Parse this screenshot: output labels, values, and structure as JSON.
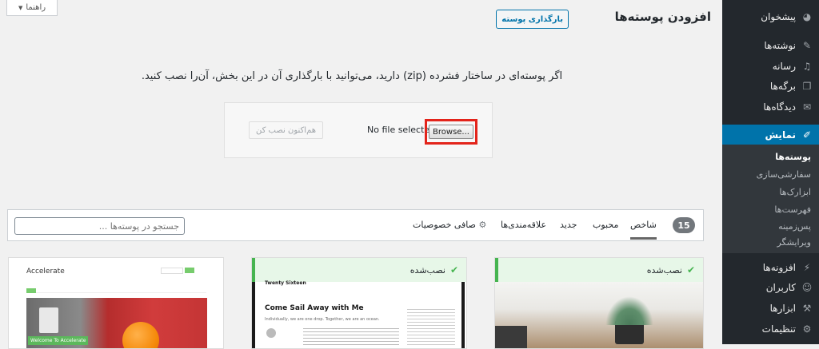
{
  "help_tab": "راهنما",
  "page": {
    "title": "افزودن پوسته‌ها",
    "upload_button": "بارگذاری پوسته",
    "instruction": "اگر پوسته‌ای در ساختار فشرده (zip) دارید، می‌توانید با بارگذاری آن در این بخش، آن‌را نصب کنید.",
    "install_now": "هم‌اکنون نصب کن",
    "no_file": "No file selected.",
    "browse": "Browse..."
  },
  "sidebar": {
    "items": [
      {
        "label": "پیشخوان",
        "icon": "dashboard-icon",
        "glyph": "◕"
      },
      {
        "label": "نوشته‌ها",
        "icon": "pin-icon",
        "glyph": "✎"
      },
      {
        "label": "رسانه",
        "icon": "media-icon",
        "glyph": "♫"
      },
      {
        "label": "برگه‌ها",
        "icon": "pages-icon",
        "glyph": "❐"
      },
      {
        "label": "دیدگاه‌ها",
        "icon": "comments-icon",
        "glyph": "✉"
      },
      {
        "label": "نمایش",
        "icon": "appearance-icon",
        "glyph": "✐"
      },
      {
        "label": "افزونه‌ها",
        "icon": "plugins-icon",
        "glyph": "⚡"
      },
      {
        "label": "کاربران",
        "icon": "users-icon",
        "glyph": "☺"
      },
      {
        "label": "ابزارها",
        "icon": "tools-icon",
        "glyph": "⚒"
      },
      {
        "label": "تنظیمات",
        "icon": "settings-icon",
        "glyph": "⚙"
      }
    ],
    "submenu": [
      "پوسته‌ها",
      "سفارشی‌سازی",
      "ابزارک‌ها",
      "فهرست‌ها",
      "پس‌زمینه",
      "ویرایشگر"
    ]
  },
  "filter": {
    "count": "15",
    "tabs": [
      "شاخص",
      "محبوب",
      "جدید",
      "علاقه‌مندی‌ها"
    ],
    "feature_filter": "صافی خصوصیات",
    "search_placeholder": "جستجو در پوسته‌ها ..."
  },
  "themes": {
    "installed_label": "نصب‌شده",
    "accelerate": {
      "name": "Accelerate",
      "nav_button": "Welcome To Accelerate"
    },
    "sail": {
      "heading": "Come Sail Away with Me",
      "subtitle": "Individually, we are one drop. Together, we are an ocean.",
      "blog_title": "Twenty Sixteen"
    }
  },
  "colors": {
    "accent": "#0073aa",
    "sidebar": "#23282d",
    "highlight": "#e3241b",
    "installed": "#46b450"
  }
}
